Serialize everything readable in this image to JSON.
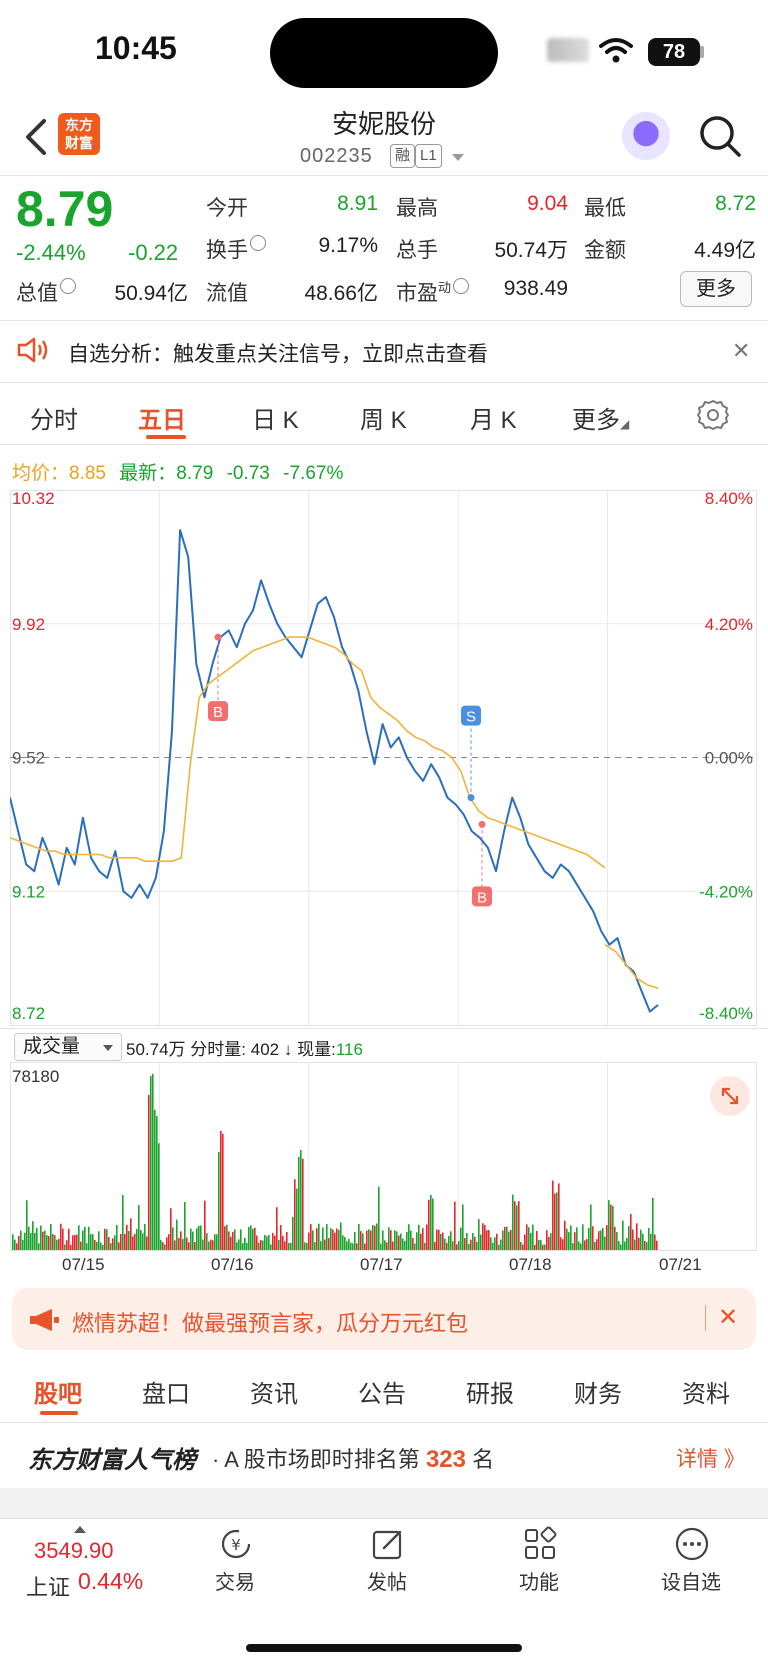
{
  "status": {
    "time": "10:45",
    "battery": "78"
  },
  "header": {
    "logo_l1": "东方",
    "logo_l2": "财富",
    "title": "安妮股份",
    "code": "002235",
    "tag1": "融",
    "tag2": "L1"
  },
  "quote": {
    "price": "8.79",
    "change_pct": "-2.44%",
    "change_amt": "-0.22",
    "open_label": "今开",
    "open": "8.91",
    "high_label": "最高",
    "high": "9.04",
    "low_label": "最低",
    "low": "8.72",
    "turnover_label": "换手",
    "turnover": "9.17%",
    "volume_label": "总手",
    "volume": "50.74万",
    "amount_label": "金额",
    "amount": "4.49亿",
    "mktcap_label": "总值",
    "mktcap": "50.94亿",
    "float_label": "流值",
    "float": "48.66亿",
    "pe_label": "市盈",
    "pe_sup": "动",
    "pe": "938.49",
    "more": "更多"
  },
  "analysis": {
    "text": "自选分析：触发重点关注信号，立即点击查看",
    "close": "✕"
  },
  "chart_tabs": [
    "分时",
    "五日",
    "日 K",
    "周 K",
    "月 K",
    "更多"
  ],
  "avg_line": {
    "avg_label": "均价：",
    "avg": "8.85",
    "latest_label": "最新：",
    "latest": "8.79",
    "chg": "-0.73",
    "pct": "-7.67%"
  },
  "chart_data": {
    "type": "line",
    "title": "",
    "y_left_ticks": [
      "10.32",
      "9.92",
      "9.52",
      "9.12",
      "8.72"
    ],
    "y_right_ticks": [
      "8.40%",
      "4.20%",
      "0.00%",
      "-4.20%",
      "-8.40%"
    ],
    "ylim": [
      8.72,
      10.32
    ],
    "dates": [
      "07/15",
      "07/16",
      "07/17",
      "07/18",
      "07/21"
    ],
    "markers": [
      "B",
      "S",
      "B"
    ],
    "series": [
      {
        "color": "#2a6ebd",
        "values": [
          9.4,
          9.3,
          9.2,
          9.18,
          9.28,
          9.22,
          9.14,
          9.25,
          9.2,
          9.34,
          9.22,
          9.18,
          9.16,
          9.24,
          9.12,
          9.1,
          9.14,
          9.1,
          9.16,
          9.3,
          9.6,
          10.2,
          10.12,
          9.8,
          9.7,
          9.8,
          9.88,
          9.9,
          9.85,
          9.92,
          9.96,
          10.05,
          9.98,
          9.92,
          9.88,
          9.85,
          9.82,
          9.9,
          9.98,
          10.0,
          9.94,
          9.85,
          9.8,
          9.72,
          9.6,
          9.5,
          9.62,
          9.55,
          9.58,
          9.52,
          9.48,
          9.45,
          9.5,
          9.46,
          9.4,
          9.38,
          9.35,
          9.3,
          9.28,
          9.25,
          9.18,
          9.3,
          9.4,
          9.34,
          9.26,
          9.22,
          9.18,
          9.16,
          9.2,
          9.18,
          9.14,
          9.1,
          9.06,
          9.0,
          8.96,
          8.98,
          8.9,
          8.88,
          8.82,
          8.76,
          8.78
        ]
      },
      {
        "color": "#f0b43c",
        "values": [
          9.28,
          9.27,
          9.26,
          9.25,
          9.24,
          9.24,
          9.23,
          9.23,
          9.23,
          9.23,
          9.23,
          9.22,
          9.22,
          9.22,
          9.22,
          9.21,
          9.21,
          9.21,
          9.21,
          9.22,
          9.5,
          9.7,
          9.74,
          9.76,
          9.78,
          9.8,
          9.82,
          9.84,
          9.85,
          9.86,
          9.87,
          9.88,
          9.88,
          9.88,
          9.87,
          9.86,
          9.85,
          9.83,
          9.8,
          9.78,
          9.7,
          9.67,
          9.65,
          9.63,
          9.6,
          9.58,
          9.57,
          9.55,
          9.54,
          9.52,
          9.48,
          9.4,
          9.36,
          9.34,
          9.33,
          9.32,
          9.31,
          9.3,
          9.29,
          9.28,
          9.27,
          9.26,
          9.25,
          9.24,
          9.23,
          9.21,
          9.19
        ]
      },
      {
        "color": "#f0b43c",
        "values": [
          8.96,
          8.94,
          8.9,
          8.86,
          8.84,
          8.83
        ]
      }
    ]
  },
  "volume": {
    "selector": "成交量",
    "total": "50.74万",
    "tick_label": "分时量:",
    "tick": "402",
    "arrow": "↓",
    "now_label": "现量:",
    "now": "116",
    "max": "78180"
  },
  "promo": {
    "text": "燃情苏超！做最强预言家，瓜分万元红包",
    "close": "✕"
  },
  "bottom_tabs": [
    "股吧",
    "盘口",
    "资讯",
    "公告",
    "研报",
    "财务",
    "资料"
  ],
  "rank": {
    "brand": "东方财富人气榜",
    "dot": "·",
    "pre": "A 股市场即时排名第",
    "num": "323",
    "post": "名",
    "detail": "详情 》"
  },
  "bottom_bar": {
    "index_value": "3549.90",
    "index_name": "上证",
    "index_pct": "0.44%",
    "items": [
      "交易",
      "发帖",
      "功能",
      "设自选"
    ]
  }
}
